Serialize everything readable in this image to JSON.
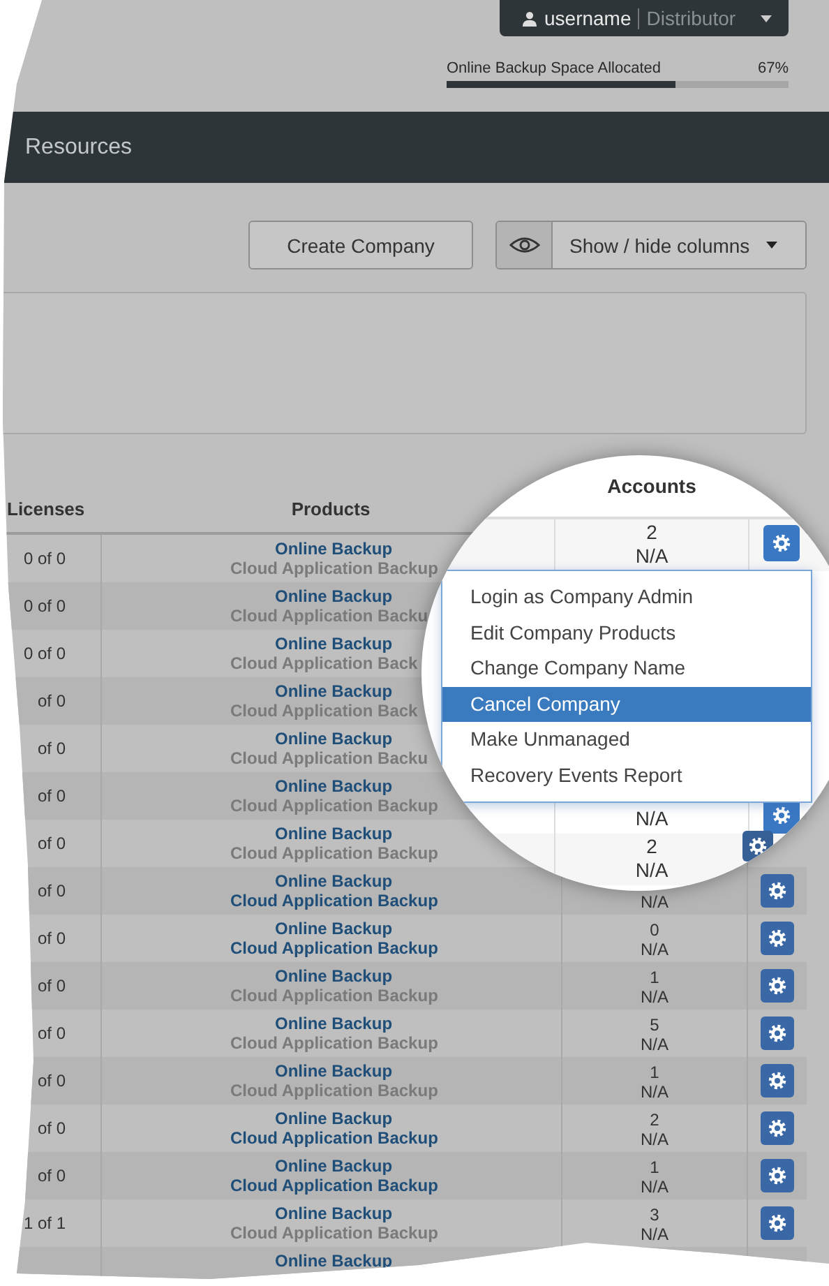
{
  "user_menu": {
    "username": "username",
    "role": "Distributor"
  },
  "storage": {
    "label": "Online Backup Space Allocated",
    "reading": "67%",
    "level": 0.67
  },
  "header": {
    "title": "Resources"
  },
  "toolbar": {
    "create_button": "Create Company",
    "columns_button": "Show / hide columns"
  },
  "table": {
    "columns": [
      "Licenses",
      "Products"
    ],
    "rows": [
      {
        "licenses": "0 of 0",
        "products": [
          {
            "name": "Online Backup",
            "active": true
          },
          {
            "name": "Cloud Application Backup",
            "active": false
          }
        ]
      },
      {
        "licenses": "0 of 0",
        "products": [
          {
            "name": "Online Backup",
            "active": true
          },
          {
            "name": "Cloud Application Backu",
            "active": false
          }
        ]
      },
      {
        "licenses": "0 of 0",
        "products": [
          {
            "name": "Online Backup",
            "active": true
          },
          {
            "name": "Cloud Application Back",
            "active": false
          }
        ]
      },
      {
        "licenses": "of 0",
        "products": [
          {
            "name": "Online Backup",
            "active": true
          },
          {
            "name": "Cloud Application Back",
            "active": false
          }
        ]
      },
      {
        "licenses": "of 0",
        "products": [
          {
            "name": "Online Backup",
            "active": true
          },
          {
            "name": "Cloud Application Backu",
            "active": false
          }
        ]
      },
      {
        "licenses": "of 0",
        "products": [
          {
            "name": "Online Backup",
            "active": true
          },
          {
            "name": "Cloud Application Backup",
            "active": false
          }
        ]
      },
      {
        "licenses": "of 0",
        "products": [
          {
            "name": "Online Backup",
            "active": true
          },
          {
            "name": "Cloud Application Backup",
            "active": false
          }
        ]
      },
      {
        "licenses": "of 0",
        "products": [
          {
            "name": "Online Backup",
            "active": true
          },
          {
            "name": "Cloud Application Backup",
            "active": true
          }
        ],
        "accounts": [
          "N/A"
        ]
      },
      {
        "licenses": "of 0",
        "products": [
          {
            "name": "Online Backup",
            "active": true
          },
          {
            "name": "Cloud Application Backup",
            "active": true
          }
        ],
        "accounts": [
          "0",
          "N/A"
        ]
      },
      {
        "licenses": "of 0",
        "products": [
          {
            "name": "Online Backup",
            "active": true
          },
          {
            "name": "Cloud Application Backup",
            "active": false
          }
        ],
        "accounts": [
          "1",
          "N/A"
        ]
      },
      {
        "licenses": "of 0",
        "products": [
          {
            "name": "Online Backup",
            "active": true
          },
          {
            "name": "Cloud Application Backup",
            "active": false
          }
        ],
        "accounts": [
          "5",
          "N/A"
        ]
      },
      {
        "licenses": "of 0",
        "products": [
          {
            "name": "Online Backup",
            "active": true
          },
          {
            "name": "Cloud Application Backup",
            "active": false
          }
        ],
        "accounts": [
          "1",
          "N/A"
        ]
      },
      {
        "licenses": "of 0",
        "products": [
          {
            "name": "Online Backup",
            "active": true
          },
          {
            "name": "Cloud Application Backup",
            "active": true
          }
        ],
        "accounts": [
          "2",
          "N/A"
        ]
      },
      {
        "licenses": "of 0",
        "products": [
          {
            "name": "Online Backup",
            "active": true
          },
          {
            "name": "Cloud Application Backup",
            "active": true
          }
        ],
        "accounts": [
          "1",
          "N/A"
        ]
      },
      {
        "licenses": "1 of 1",
        "products": [
          {
            "name": "Online Backup",
            "active": true
          },
          {
            "name": "Cloud Application Backup",
            "active": false
          }
        ],
        "accounts": [
          "3",
          "N/A"
        ]
      },
      {
        "products": [
          {
            "name": "Online Backup",
            "active": true
          }
        ]
      }
    ]
  },
  "magnifier": {
    "column": "Accounts",
    "rows": [
      {
        "accounts": [
          "2",
          "N/A"
        ]
      },
      {
        "accounts": [
          "N/A"
        ]
      },
      {
        "accounts": [
          "2",
          "N/A"
        ]
      }
    ],
    "menu": [
      {
        "label": "Login as Company Admin",
        "selected": false
      },
      {
        "label": "Edit Company Products",
        "selected": false
      },
      {
        "label": "Change Company Name",
        "selected": false
      },
      {
        "label": "Cancel Company",
        "selected": true
      },
      {
        "label": "Make Unmanaged",
        "selected": false
      },
      {
        "label": "Recovery Events Report",
        "selected": false
      }
    ]
  }
}
